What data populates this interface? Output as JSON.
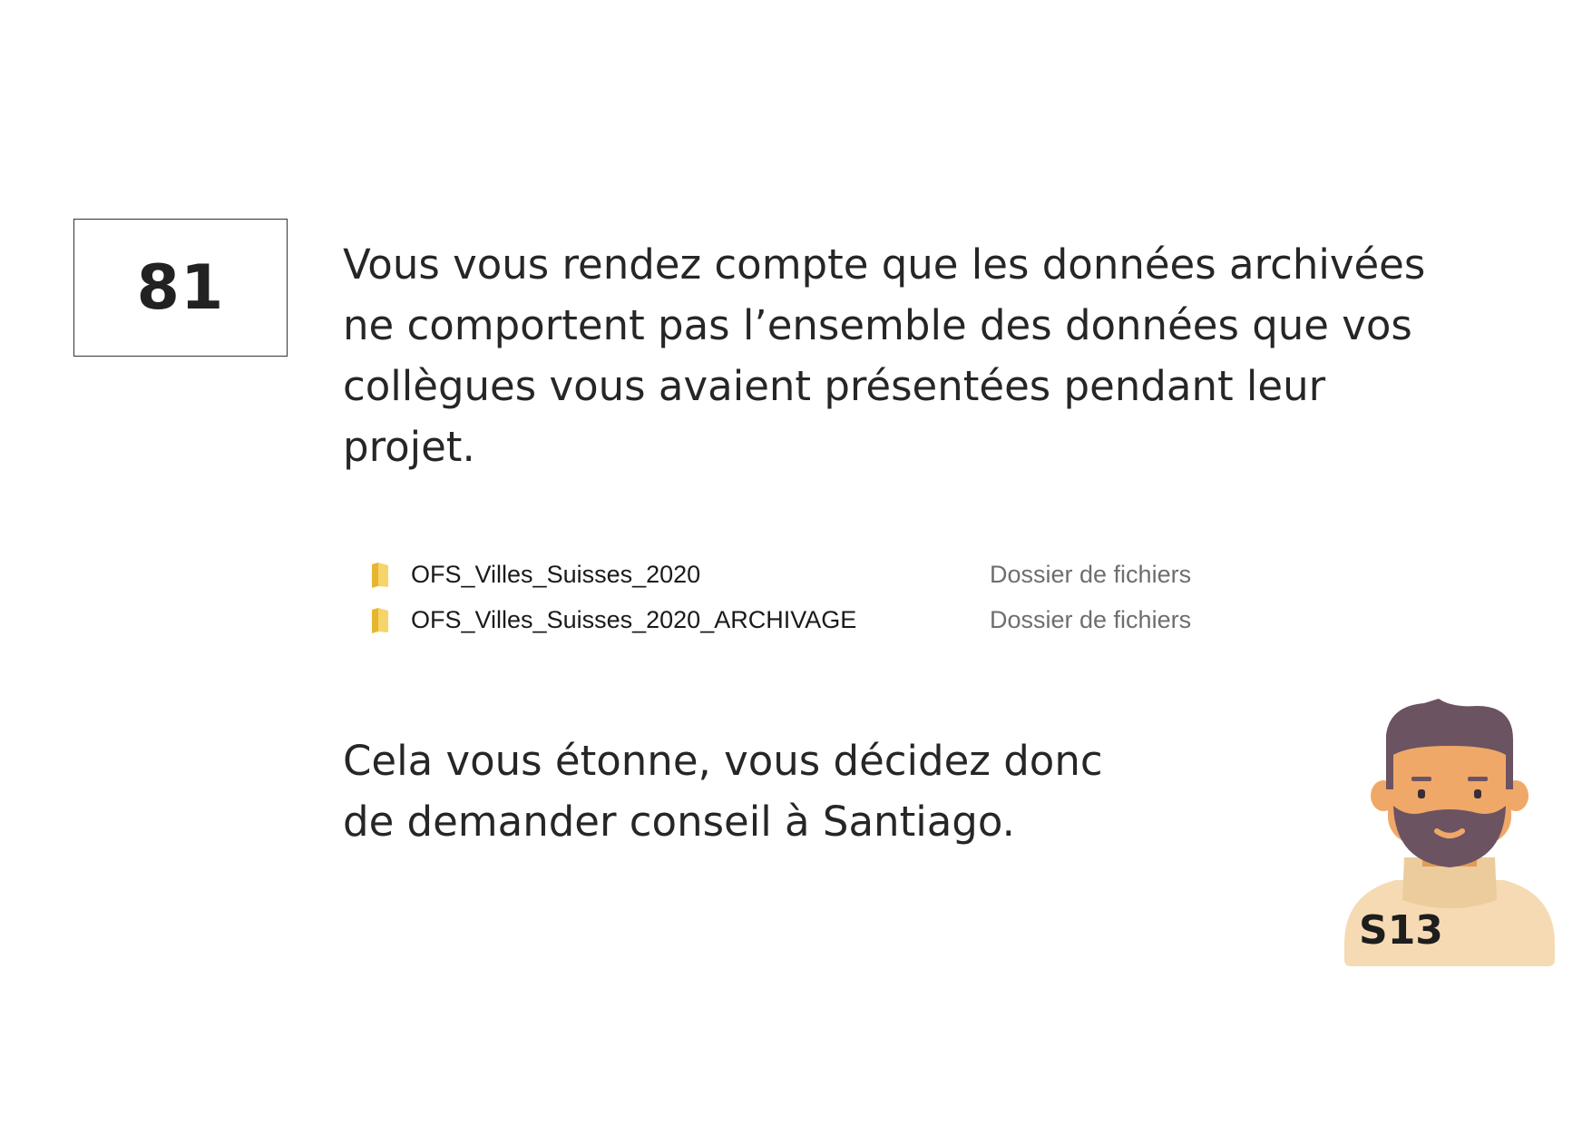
{
  "card": {
    "number": "81"
  },
  "intro_text": "Vous vous rendez compte que les données archivées ne comportent pas l’ensemble des données que vos collègues vous avaient présentées pendant leur projet.",
  "file_list": [
    {
      "name": "OFS_Villes_Suisses_2020",
      "type": "Dossier de fichiers",
      "icon": "folder-icon"
    },
    {
      "name": "OFS_Villes_Suisses_2020_ARCHIVAGE",
      "type": "Dossier de fichiers",
      "icon": "folder-icon"
    }
  ],
  "outro_lines": [
    "Cela vous étonne, vous décidez donc",
    "de demander conseil à Santiago."
  ],
  "character": {
    "code": "S13",
    "icon": "bearded-man-avatar-icon"
  },
  "colors": {
    "folder": "#f2c94c",
    "hair": "#6b5361",
    "skin": "#f0a868",
    "beard": "#6b5361",
    "sweater": "#f5dab3"
  }
}
